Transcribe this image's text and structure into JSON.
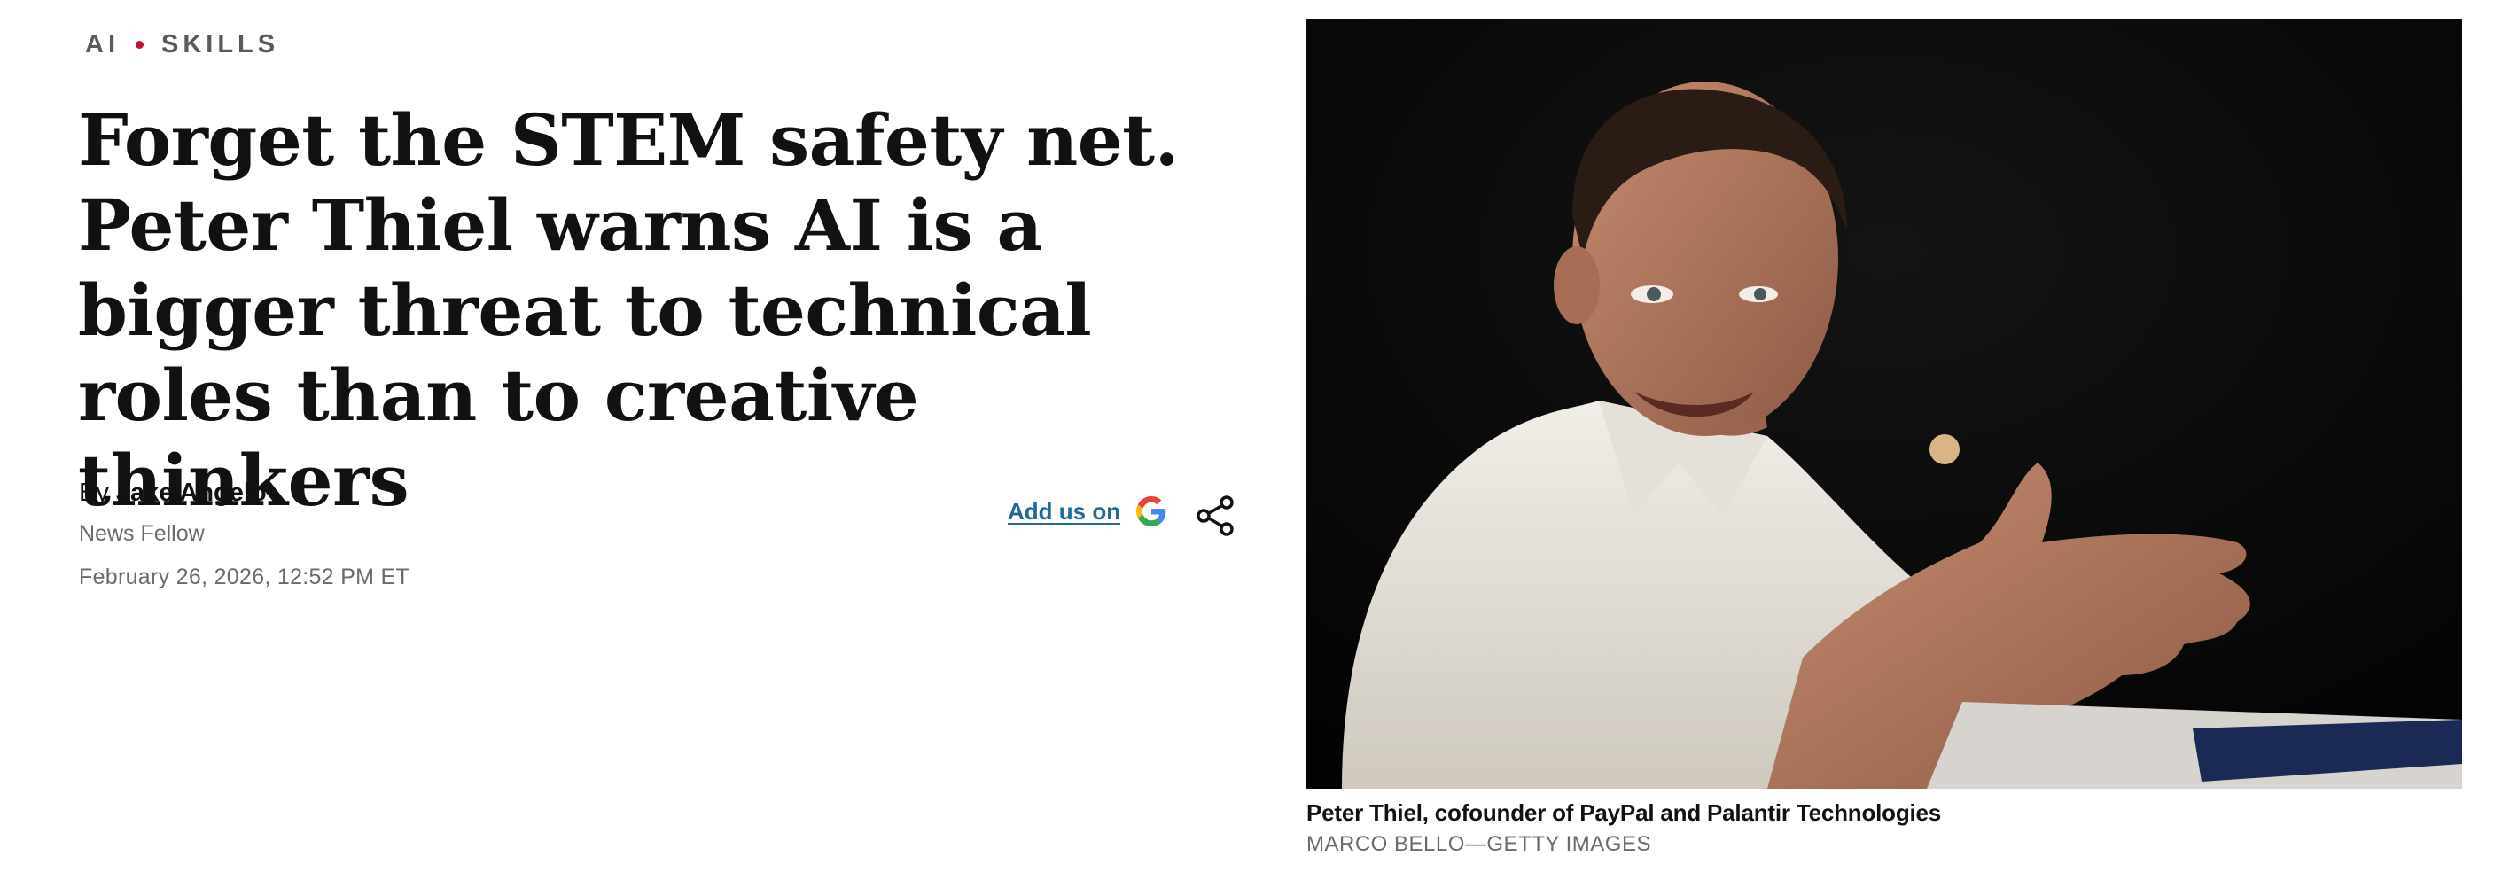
{
  "topics": {
    "first": "AI",
    "second": "SKILLS",
    "separator_color": "#c8102e"
  },
  "headline": "Forget the STEM safety net. Peter Thiel warns AI is a bigger threat to technical roles than to creative thinkers",
  "byline": {
    "prefix": "By",
    "author": "Jake Angelo",
    "role": "News Fellow",
    "date": "February 26, 2026, 12:52 PM ET"
  },
  "actions": {
    "add_us_label": "Add us on",
    "add_us_icon": "google-icon",
    "share_icon": "share-icon",
    "link_color": "#1f6a9a"
  },
  "image": {
    "caption": "Peter Thiel, cofounder of PayPal and Palantir Technologies",
    "credit": "MARCO BELLO—GETTY IMAGES",
    "background": "#060606"
  }
}
